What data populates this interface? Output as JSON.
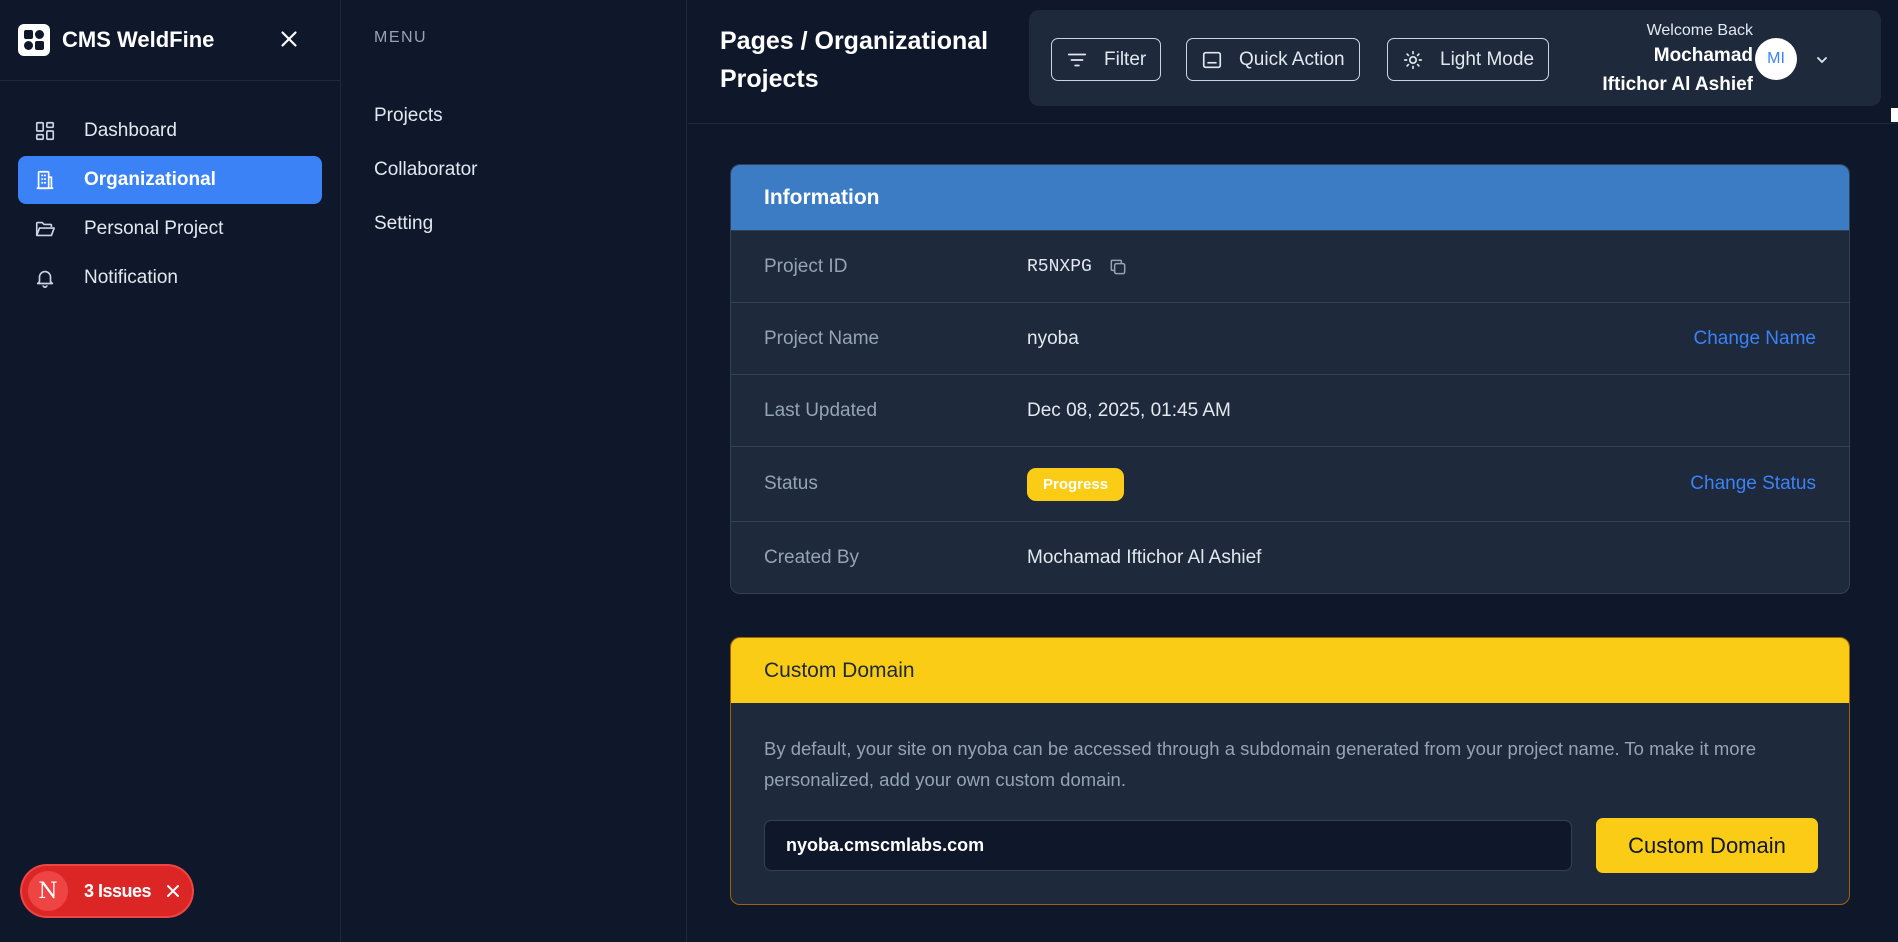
{
  "brand": {
    "title": "CMS WeldFine"
  },
  "sidebar": {
    "items": [
      {
        "label": "Dashboard",
        "icon": "dashboard-grid-icon"
      },
      {
        "label": "Organizational",
        "icon": "building-icon",
        "active": true
      },
      {
        "label": "Personal Project",
        "icon": "folder-open-icon"
      },
      {
        "label": "Notification",
        "icon": "bell-icon"
      }
    ]
  },
  "issues": {
    "letter": "N",
    "label": "3 Issues"
  },
  "menu": {
    "heading": "MENU",
    "items": [
      "Projects",
      "Collaborator",
      "Setting"
    ]
  },
  "header": {
    "title": "Pages / Organizational Projects",
    "filter_label": "Filter",
    "quick_action_label": "Quick Action",
    "light_mode_label": "Light Mode",
    "welcome": "Welcome Back",
    "user_line1": "Mochamad",
    "user_line2": "Iftichor Al Ashief",
    "avatar_initials": "MI"
  },
  "info": {
    "title": "Information",
    "project_id_label": "Project ID",
    "project_id": "R5NXPG",
    "project_name_label": "Project Name",
    "project_name": "nyoba",
    "change_name": "Change Name",
    "last_updated_label": "Last Updated",
    "last_updated": "Dec 08, 2025, 01:45 AM",
    "status_label": "Status",
    "status": "Progress",
    "change_status": "Change Status",
    "created_by_label": "Created By",
    "created_by": "Mochamad Iftichor Al Ashief"
  },
  "domain": {
    "title": "Custom Domain",
    "description": "By default, your site on nyoba can be accessed through a subdomain generated from your project name. To make it more personalized, add your own custom domain.",
    "input_value": "nyoba.cmscmlabs.com",
    "button_label": "Custom Domain"
  },
  "colors": {
    "background": "#0f172a",
    "panel": "#1e293b",
    "accent_blue": "#3b82f6",
    "info_header": "#3b7cc4",
    "accent_yellow": "#facc15",
    "danger": "#dc2626"
  }
}
